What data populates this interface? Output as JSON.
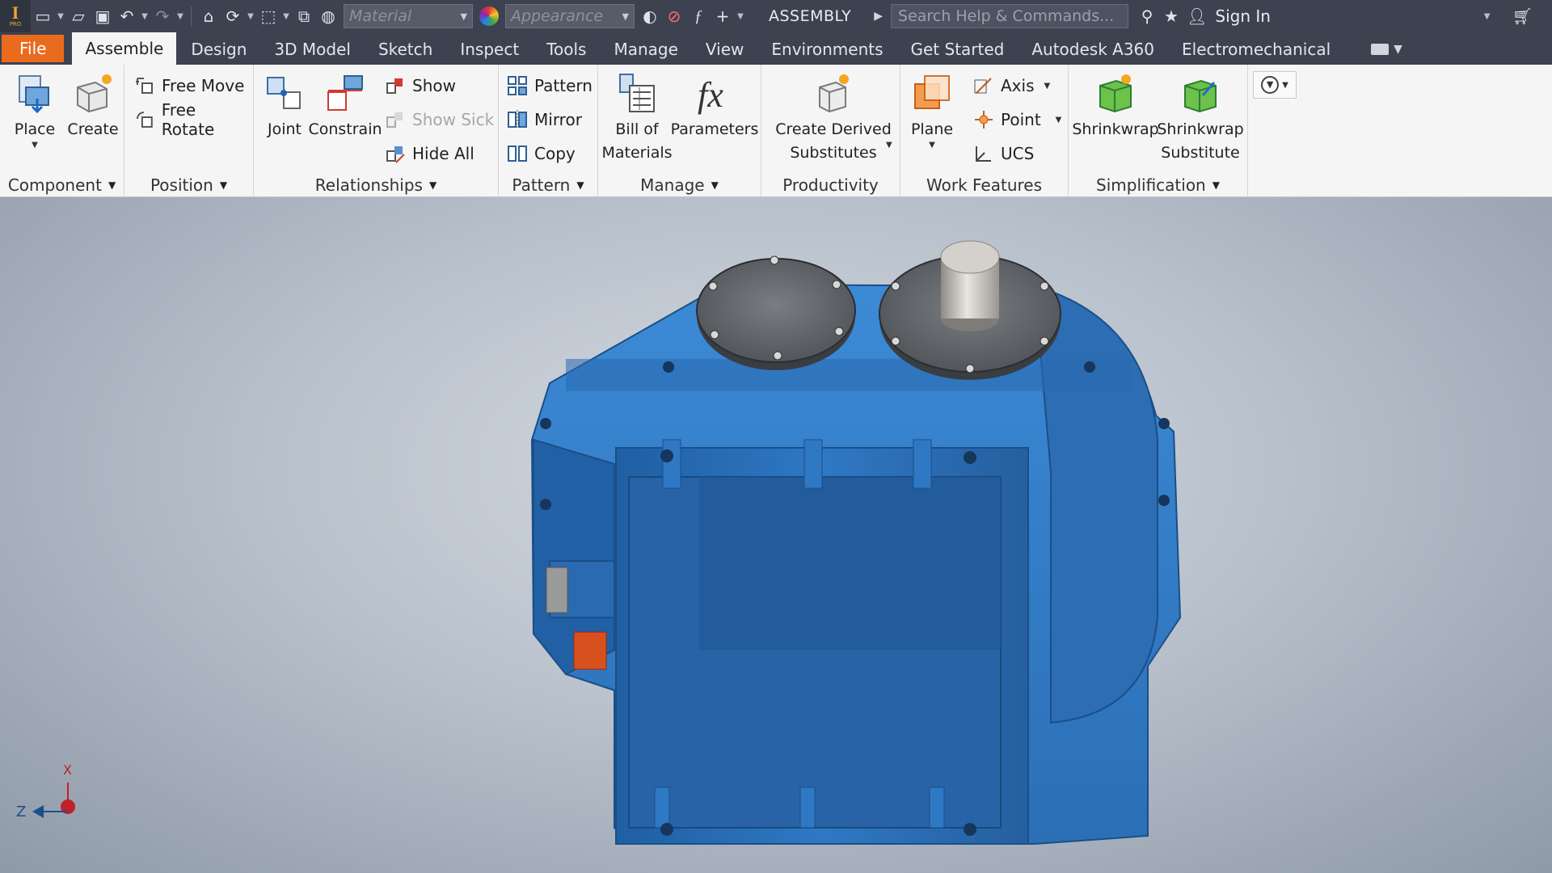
{
  "qat": {
    "material_placeholder": "Material",
    "appearance_placeholder": "Appearance",
    "document_type": "ASSEMBLY",
    "search_placeholder": "Search Help & Commands...",
    "sign_in": "Sign In",
    "logo_subtext": "PRO"
  },
  "tabs": [
    {
      "label": "File"
    },
    {
      "label": "Assemble"
    },
    {
      "label": "Design"
    },
    {
      "label": "3D Model"
    },
    {
      "label": "Sketch"
    },
    {
      "label": "Inspect"
    },
    {
      "label": "Tools"
    },
    {
      "label": "Manage"
    },
    {
      "label": "View"
    },
    {
      "label": "Environments"
    },
    {
      "label": "Get Started"
    },
    {
      "label": "Autodesk A360"
    },
    {
      "label": "Electromechanical"
    }
  ],
  "ribbon": {
    "component": {
      "label": "Component",
      "place": "Place",
      "create": "Create"
    },
    "position": {
      "label": "Position",
      "free_move": "Free Move",
      "free_rotate": "Free Rotate"
    },
    "relationships": {
      "label": "Relationships",
      "joint": "Joint",
      "constrain": "Constrain",
      "show": "Show",
      "show_sick": "Show Sick",
      "hide_all": "Hide All"
    },
    "pattern": {
      "label": "Pattern",
      "pattern": "Pattern",
      "mirror": "Mirror",
      "copy": "Copy"
    },
    "manage": {
      "label": "Manage",
      "bom_line1": "Bill of",
      "bom_line2": "Materials",
      "parameters": "Parameters"
    },
    "productivity": {
      "label": "Productivity",
      "derived_line1": "Create Derived",
      "derived_line2": "Substitutes"
    },
    "work_features": {
      "label": "Work Features",
      "plane": "Plane",
      "axis": "Axis",
      "point": "Point",
      "ucs": "UCS"
    },
    "simplification": {
      "label": "Simplification",
      "shrinkwrap": "Shrinkwrap",
      "shrinkwrap_sub_line1": "Shrinkwrap",
      "shrinkwrap_sub_line2": "Substitute"
    }
  },
  "triad": {
    "x_label": "X",
    "z_label": "Z"
  },
  "colors": {
    "accent_file": "#ea6b1e",
    "model_blue": "#2f78c4",
    "toolbar_dark": "#3c4250"
  }
}
